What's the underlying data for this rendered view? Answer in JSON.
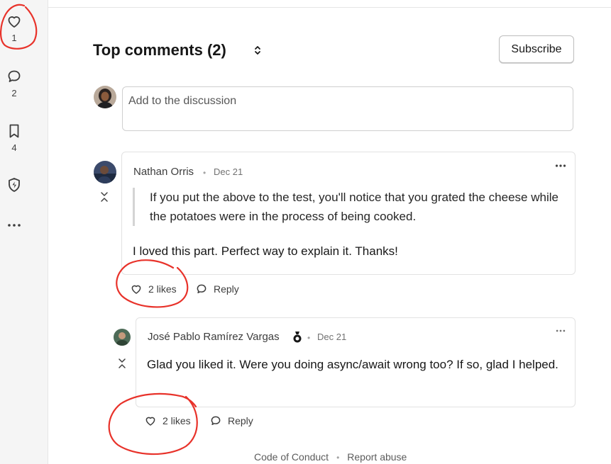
{
  "sidebar": {
    "reactions_count": "1",
    "comments_count": "2",
    "bookmarks_count": "4"
  },
  "comments_section": {
    "title": "Top comments (2)",
    "subscribe_label": "Subscribe",
    "composer_placeholder": "Add to the discussion"
  },
  "comments": [
    {
      "author": "Nathan Orris",
      "separator": "•",
      "date": "Dec 21",
      "quote": "If you put the above to the test, you'll notice that you grated the cheese while the potatoes were in the process of being cooked.",
      "body": "I loved this part. Perfect way to explain it. Thanks!",
      "likes_label": "2 likes",
      "reply_label": "Reply"
    },
    {
      "author": "José Pablo Ramírez Vargas",
      "separator": "•",
      "date": "Dec 21",
      "body": "Glad you liked it. Were you doing async/await wrong too? If so, glad I helped.",
      "likes_label": "2 likes",
      "reply_label": "Reply"
    }
  ],
  "footer": {
    "code_of_conduct": "Code of Conduct",
    "separator": "•",
    "report_abuse": "Report abuse"
  },
  "colors": {
    "annotation_red": "#e8322a",
    "rail_background": "#f5f5f5"
  }
}
